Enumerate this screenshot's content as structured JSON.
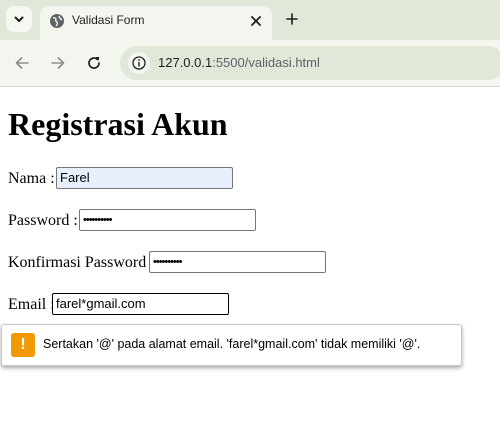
{
  "browser": {
    "tab_title": "Validasi Form",
    "url_host": "127.0.0.1",
    "url_rest": ":5500/validasi.html"
  },
  "page": {
    "heading": "Registrasi Akun",
    "fields": {
      "nama": {
        "label": "Nama :",
        "value": "Farel"
      },
      "password": {
        "label": "Password :",
        "value": "••••••••••"
      },
      "konfirmasi": {
        "label": "Konfirmasi Password :",
        "value": "••••••••••"
      },
      "email": {
        "label": "Email :",
        "value": "farel*gmail.com"
      }
    }
  },
  "validation": {
    "icon": "!",
    "message": "Sertakan '@' pada alamat email. 'farel*gmail.com' tidak memiliki '@'."
  },
  "colors": {
    "tabstrip": "#dfe8d9",
    "toolbar": "#f2f6ef",
    "autofill": "#e8f0fe",
    "warning": "#f29900"
  }
}
